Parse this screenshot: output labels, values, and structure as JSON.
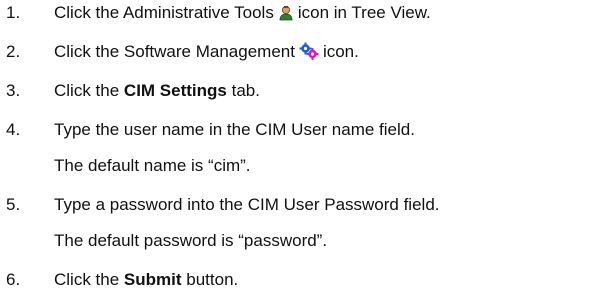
{
  "steps": [
    {
      "number": "1.",
      "before": "Click the Administrative Tools",
      "icon": "admin-tools-person-icon",
      "after": "icon in Tree View."
    },
    {
      "number": "2.",
      "before": "Click the Software Management",
      "icon": "software-management-gears-icon",
      "after": "icon."
    },
    {
      "number": "3.",
      "before": "Click the",
      "bold": "CIM Settings",
      "after": "tab."
    },
    {
      "number": "4.",
      "line1": "Type the user name in the CIM User name field.",
      "line2": "The default name is “cim”."
    },
    {
      "number": "5.",
      "line1": "Type a password into the CIM User Password field.",
      "line2": "The default password is “password”."
    },
    {
      "number": "6.",
      "before": "Click the",
      "bold": "Submit",
      "after": "button."
    }
  ],
  "colors": {
    "text": "#111111",
    "admin_icon_head": "#d9a066",
    "admin_icon_body": "#2e7d32",
    "gear_blue": "#1e5bd8",
    "gear_magenta": "#d11fb6"
  }
}
